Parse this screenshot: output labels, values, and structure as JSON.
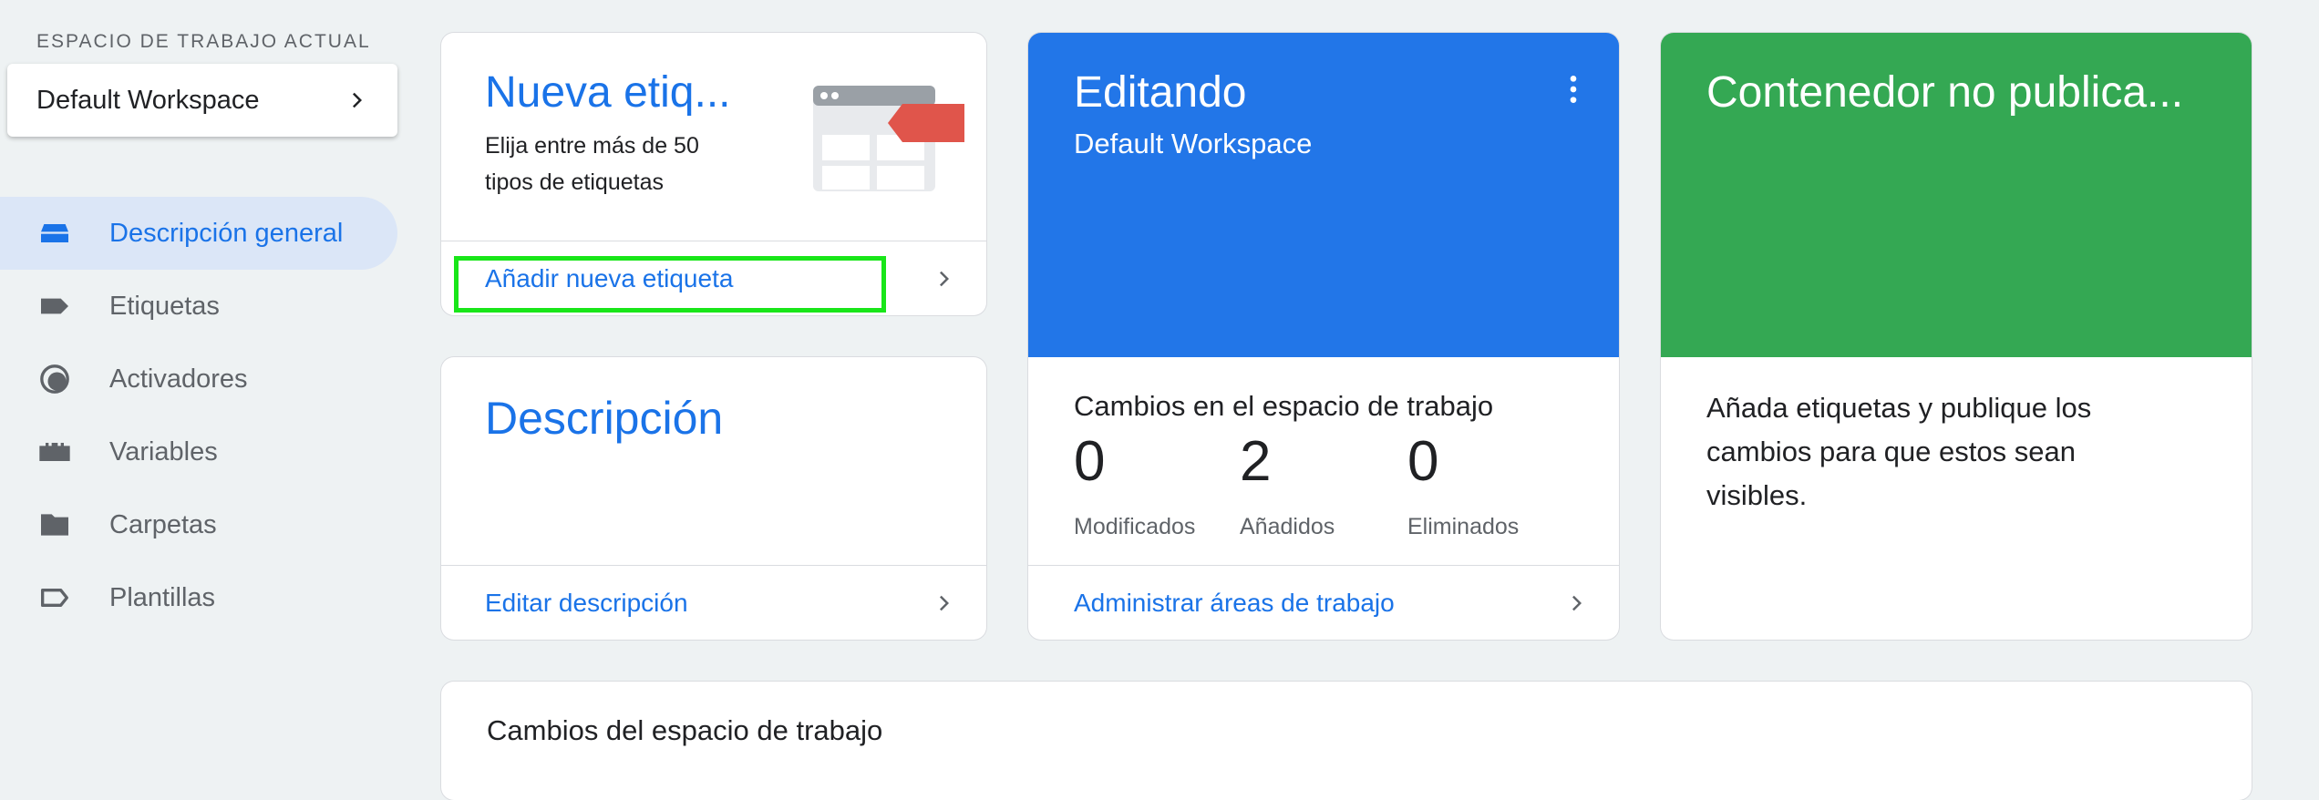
{
  "sidebar": {
    "workspace_caption": "ESPACIO DE TRABAJO ACTUAL",
    "workspace_name": "Default Workspace",
    "items": [
      {
        "label": "Descripción general",
        "icon": "overview-icon",
        "active": true
      },
      {
        "label": "Etiquetas",
        "icon": "tag-icon",
        "active": false
      },
      {
        "label": "Activadores",
        "icon": "trigger-icon",
        "active": false
      },
      {
        "label": "Variables",
        "icon": "variables-icon",
        "active": false
      },
      {
        "label": "Carpetas",
        "icon": "folder-icon",
        "active": false
      },
      {
        "label": "Plantillas",
        "icon": "template-icon",
        "active": false
      }
    ]
  },
  "new_tag_card": {
    "title": "Nueva etiq...",
    "description": "Elija entre más de 50 tipos de etiquetas",
    "action": "Añadir nueva etiqueta"
  },
  "description_card": {
    "title": "Descripción",
    "action": "Editar descripción"
  },
  "editing_card": {
    "title": "Editando",
    "workspace": "Default Workspace",
    "changes_title": "Cambios en el espacio de trabajo",
    "stats": [
      {
        "value": "0",
        "label": "Modificados"
      },
      {
        "value": "2",
        "label": "Añadidos"
      },
      {
        "value": "0",
        "label": "Eliminados"
      }
    ],
    "action": "Administrar áreas de trabajo"
  },
  "publish_card": {
    "title": "Contenedor no publica...",
    "body": "Añada etiquetas y publique los cambios para que estos sean visibles."
  },
  "workspace_changes_card": {
    "title": "Cambios del espacio de trabajo"
  },
  "colors": {
    "accent": "#1a73e8",
    "editing_banner": "#2276e8",
    "publish_banner": "#34a853",
    "highlight": "#19e619"
  }
}
